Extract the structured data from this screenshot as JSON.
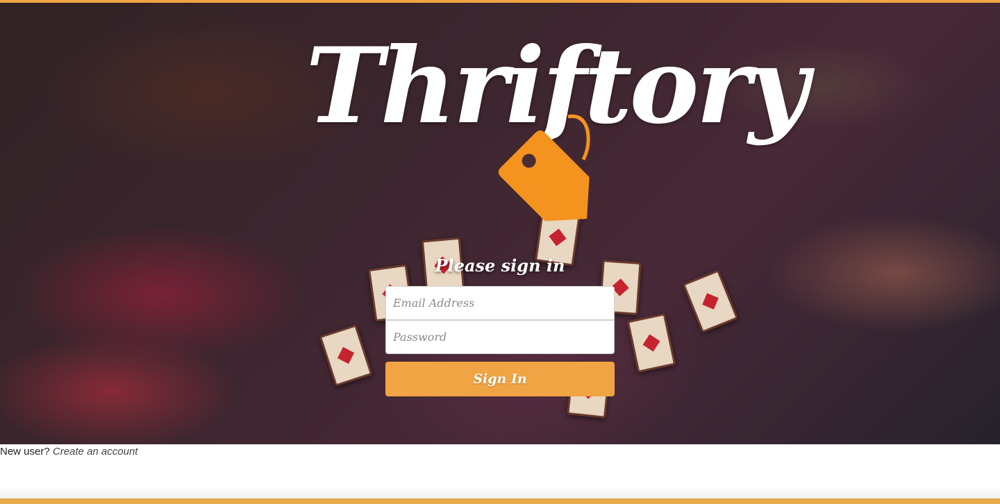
{
  "brand": {
    "name": "Thriftory",
    "logo_icon": "price-tag-icon",
    "accent_color": "#f0a444",
    "tag_color": "#f5931f"
  },
  "signin": {
    "title": "Please sign in",
    "email_placeholder": "Email Address",
    "password_placeholder": "Password",
    "button_label": "Sign In"
  },
  "register": {
    "prompt": "New user?",
    "link_label": "Create an account"
  }
}
